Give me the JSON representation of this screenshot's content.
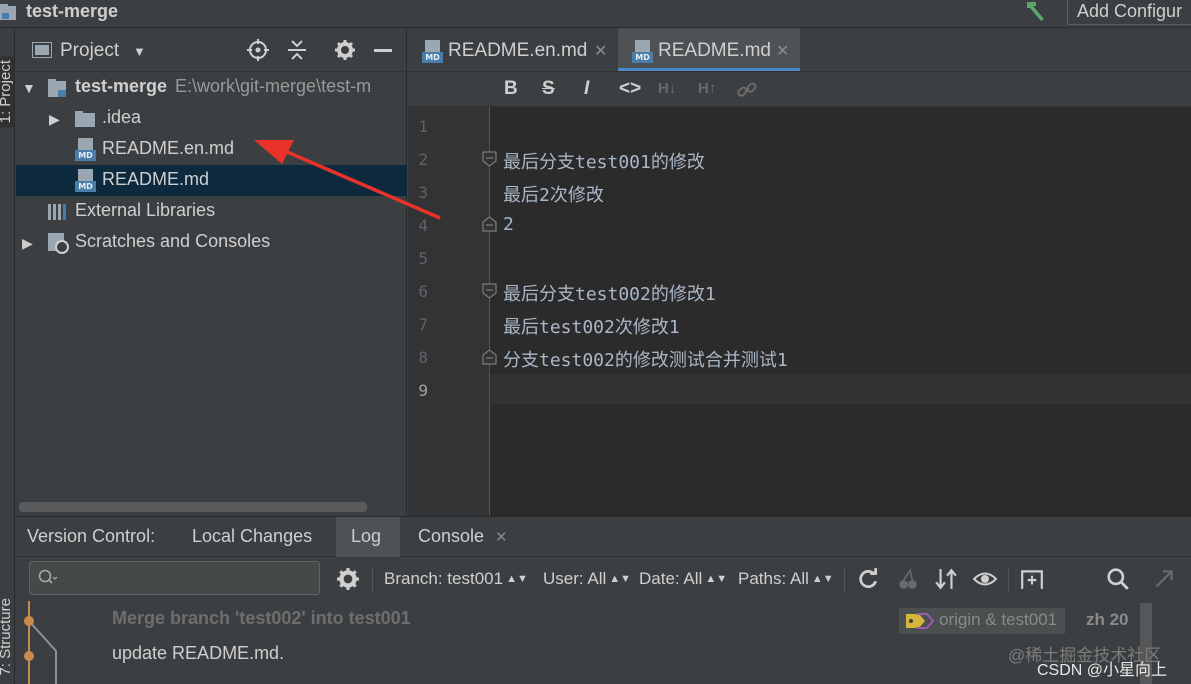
{
  "window": {
    "project_name": "test-merge",
    "add_configuration": "Add Configur"
  },
  "side_tabs": {
    "project": "1: Project",
    "structure": "7: Structure"
  },
  "project_panel": {
    "title": "Project",
    "tree": [
      {
        "label": "test-merge",
        "path": "E:\\work\\git-merge\\test-m",
        "icon": "module-folder-icon",
        "expanded": true
      },
      {
        "label": ".idea",
        "icon": "folder-icon",
        "expanded": false
      },
      {
        "label": "README.en.md",
        "icon": "markdown-file-icon"
      },
      {
        "label": "README.md",
        "icon": "markdown-file-icon",
        "selected": true
      },
      {
        "label": "External Libraries",
        "icon": "libraries-icon"
      },
      {
        "label": "Scratches and Consoles",
        "icon": "scratches-icon",
        "expanded": false
      }
    ]
  },
  "editor_tabs": [
    {
      "label": "README.en.md",
      "active": false
    },
    {
      "label": "README.md",
      "active": true
    }
  ],
  "md_toolbar": {
    "bold": "B",
    "strike": "S",
    "italic": "I",
    "code": "<>",
    "h_down": "H↓",
    "h_up": "H↑"
  },
  "editor": {
    "lines": [
      {
        "n": "1",
        "text": ""
      },
      {
        "n": "2",
        "text": "最后分支test001的修改"
      },
      {
        "n": "3",
        "text": "最后2次修改"
      },
      {
        "n": "4",
        "text": "2"
      },
      {
        "n": "5",
        "text": ""
      },
      {
        "n": "6",
        "text": "最后分支test002的修改1"
      },
      {
        "n": "7",
        "text": "最后test002次修改1"
      },
      {
        "n": "8",
        "text": "分支test002的修改测试合并测试1"
      },
      {
        "n": "9",
        "text": ""
      }
    ]
  },
  "vcs": {
    "title": "Version Control:",
    "tabs": [
      "Local Changes",
      "Log",
      "Console"
    ],
    "filters": {
      "branch": "Branch: test001",
      "user": "User: All",
      "date": "Date: All",
      "paths": "Paths: All"
    },
    "commits": [
      {
        "message": "Merge branch 'test002' into test001",
        "tag": "origin & test001",
        "author": "zh 20"
      },
      {
        "message": "update README.md."
      }
    ]
  },
  "watermark": {
    "line1": "@稀土掘金技术社区",
    "line2": "CSDN @小星向上"
  },
  "colors": {
    "accent": "#4a88c7",
    "selection": "#0d293e",
    "editor_bg": "#2b2b2b",
    "annotation_arrow": "#e8322a"
  }
}
